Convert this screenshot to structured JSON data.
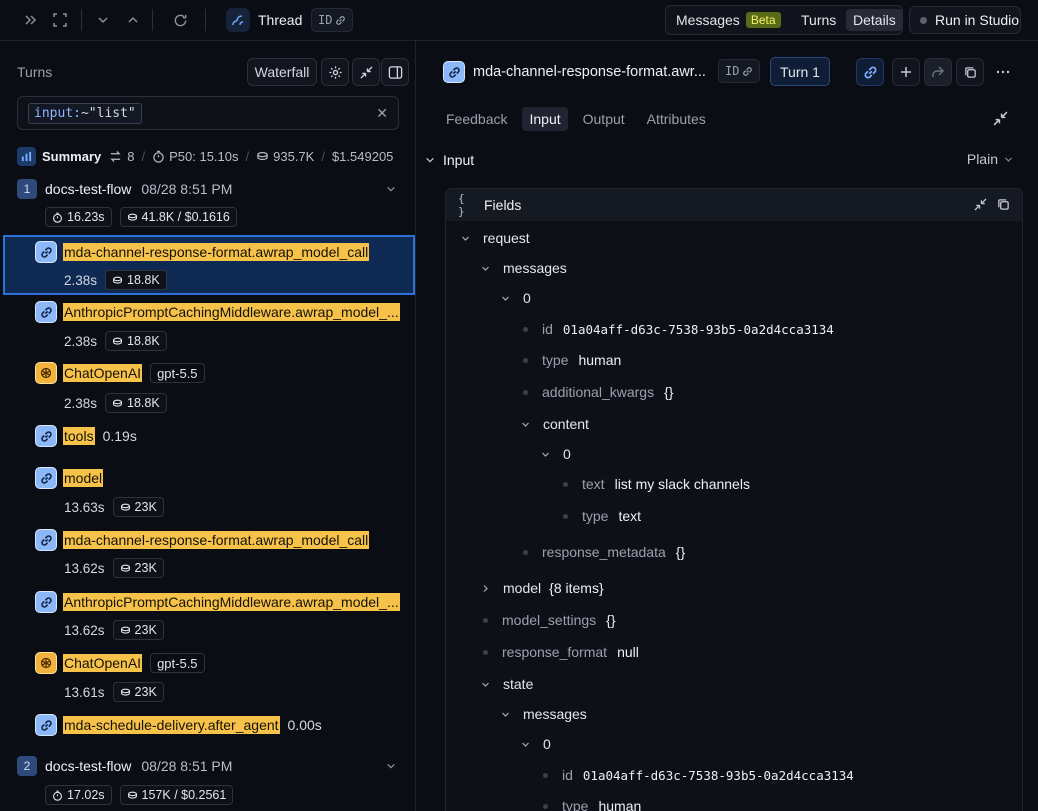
{
  "topbar": {
    "thread_title": "Thread",
    "id_label": "ID",
    "tabs": {
      "messages": "Messages",
      "beta": "Beta",
      "turns": "Turns",
      "details": "Details"
    },
    "run_in_studio": "Run in Studio"
  },
  "left": {
    "turns_label": "Turns",
    "waterfall": "Waterfall",
    "search_key": "input:",
    "search_val": "~\"list\"",
    "summary": {
      "label": "Summary",
      "turn_count": "8",
      "p50": "P50: 15.10s",
      "tokens": "935.7K",
      "cost": "$1.549205"
    },
    "flow1": {
      "num": "1",
      "name": "docs-test-flow",
      "time": "08/28 8:51 PM",
      "duration": "16.23s",
      "tokens_cost": "41.8K / $0.1616"
    },
    "runs": [
      {
        "name": "mda-channel-response-format.awrap_model_call",
        "latency": "2.38s",
        "tokens": "18.8K"
      },
      {
        "name": "AnthropicPromptCachingMiddleware.awrap_model_...",
        "latency": "2.38s",
        "tokens": "18.8K"
      },
      {
        "name": "ChatOpenAI",
        "model": "gpt-5.5",
        "latency": "2.38s",
        "tokens": "18.8K"
      },
      {
        "name": "tools",
        "inline_latency": "0.19s"
      },
      {
        "name": "model",
        "latency": "13.63s",
        "tokens": "23K"
      },
      {
        "name": "mda-channel-response-format.awrap_model_call",
        "latency": "13.62s",
        "tokens": "23K"
      },
      {
        "name": "AnthropicPromptCachingMiddleware.awrap_model_...",
        "latency": "13.62s",
        "tokens": "23K"
      },
      {
        "name": "ChatOpenAI",
        "model": "gpt-5.5",
        "latency": "13.61s",
        "tokens": "23K"
      },
      {
        "name": "mda-schedule-delivery.after_agent",
        "inline_latency": "0.00s"
      }
    ],
    "flow2": {
      "num": "2",
      "name": "docs-test-flow",
      "time": "08/28 8:51 PM",
      "duration": "17.02s",
      "tokens_cost": "157K / $0.2561"
    }
  },
  "right": {
    "title": "mda-channel-response-format.awr...",
    "id_label": "ID",
    "turn_button": "Turn 1",
    "tabs": [
      "Feedback",
      "Input",
      "Output",
      "Attributes"
    ],
    "active_tab": "Input",
    "section": "Input",
    "view_mode": "Plain",
    "fields_label": "Fields",
    "brace_icon": "{ }",
    "tree": {
      "request": "request",
      "messages": "messages",
      "idx0": "0",
      "id_k": "id",
      "id_v": "01a04aff-d63c-7538-93b5-0a2d4cca3134",
      "type_k": "type",
      "type_v": "human",
      "additional_kwargs_k": "additional_kwargs",
      "empty_obj": "{}",
      "content_k": "content",
      "text_k": "text",
      "text_v": "list my slack channels",
      "type_text_v": "text",
      "response_metadata_k": "response_metadata",
      "model_k": "model",
      "model_v": "{8 items}",
      "model_settings_k": "model_settings",
      "response_format_k": "response_format",
      "null_v": "null",
      "state_k": "state"
    }
  }
}
